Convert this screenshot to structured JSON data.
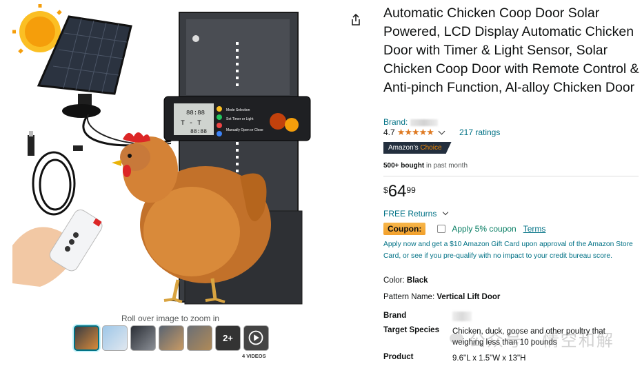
{
  "product": {
    "title": "Automatic Chicken Coop Door Solar Powered, LCD Display Automatic Chicken Door with Timer & Light Sensor, Solar Chicken Coop Door with Remote Control & Anti-pinch Function, Al-alloy Chicken Door",
    "brand_label": "Brand:",
    "rating_value": "4.7",
    "stars": "★★★★★",
    "ratings_count": "217 ratings",
    "badge_prefix": "Amazon's",
    "badge_suffix": "Choice",
    "bought_bold": "500+ bought",
    "bought_rest": "in past month",
    "price_symbol": "$",
    "price_whole": "64",
    "price_fraction": "99",
    "returns": "FREE Returns",
    "coupon_label": "Coupon:",
    "coupon_text": "Apply 5% coupon",
    "terms": "Terms",
    "gift_text": "Apply now and get a $10 Amazon Gift Card upon approval of the Amazon Store Card, or see if you pre-qualify with no impact to your credit bureau score.",
    "color_label": "Color:",
    "color_value": "Black",
    "pattern_label": "Pattern Name:",
    "pattern_value": "Vertical Lift Door"
  },
  "specs": {
    "brand_label": "Brand",
    "species_label": "Target Species",
    "species_value_1": "Chicken, duck, goose and other poultry that",
    "species_value_2": "weighing less than 10 pounds",
    "product_label": "Product",
    "product_value": "9.6\"L x 1.5\"W x 13\"H"
  },
  "gallery": {
    "zoom_hint": "Roll over image to zoom in",
    "more_count": "2+",
    "videos_label": "4 VIDEOS",
    "lcd_line1": "Mode Selection",
    "lcd_line2": "Set Timer or Light",
    "lcd_line3": "Manually Open or Close"
  },
  "watermark": "公众号 · 情空和解",
  "colors": {
    "link": "#007185",
    "star": "#de7921",
    "badge_bg": "#232f3e",
    "badge_accent": "#f08804",
    "coupon_green": "#067d62"
  }
}
